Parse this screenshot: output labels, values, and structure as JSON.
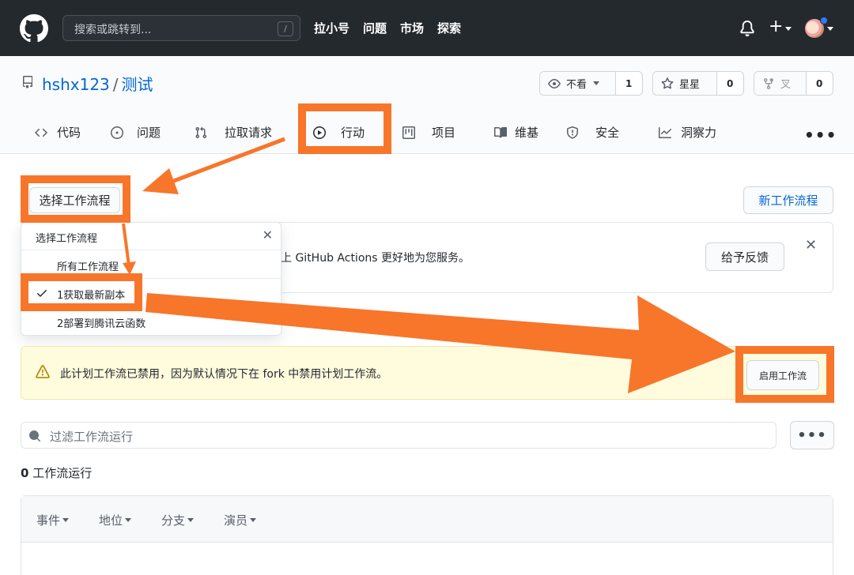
{
  "header": {
    "search_placeholder": "搜索或跳转到...",
    "search_shortcut": "/",
    "nav": [
      "拉小号",
      "问题",
      "市场",
      "探索"
    ],
    "plus": "+"
  },
  "repo": {
    "owner": "hshx123",
    "separator": "/",
    "name": "测试",
    "watch": {
      "label": "不看",
      "count": "1"
    },
    "star": {
      "label": "星星",
      "count": "0"
    },
    "fork": {
      "label": "叉",
      "count": "0"
    }
  },
  "tabs": [
    {
      "label": "代码",
      "icon": "code-icon"
    },
    {
      "label": "问题",
      "icon": "issue-icon"
    },
    {
      "label": "拉取请求",
      "icon": "pull-request-icon"
    },
    {
      "label": "行动",
      "icon": "play-icon"
    },
    {
      "label": "项目",
      "icon": "project-icon"
    },
    {
      "label": "维基",
      "icon": "book-icon"
    },
    {
      "label": "安全",
      "icon": "shield-icon"
    },
    {
      "label": "洞察力",
      "icon": "graph-icon"
    }
  ],
  "tabs_more": "•••",
  "workflow": {
    "select_label": "选择工作流程",
    "new_label": "新工作流程"
  },
  "dropdown": {
    "title": "选择工作流程",
    "close": "✕",
    "items": [
      "所有工作流程",
      "1获取最新副本",
      "2部署到腾讯云函数"
    ],
    "selected_index": 1
  },
  "feedback": {
    "text": "上 GitHub Actions 更好地为您服务。",
    "button": "给予反馈",
    "close": "✕"
  },
  "warning": {
    "text": "此计划工作流已禁用，因为默认情况下在 fork 中禁用计划工作流。",
    "button": "启用工作流"
  },
  "filter": {
    "placeholder": "过滤工作流运行",
    "more": "•••"
  },
  "runs": {
    "count": "0",
    "label": "工作流运行",
    "filters": [
      "事件",
      "地位",
      "分支",
      "演员"
    ]
  },
  "colors": {
    "header_bg": "#24292e",
    "link": "#0366d6",
    "annotation": "#f7762a",
    "warning_bg": "#fffbdd"
  }
}
